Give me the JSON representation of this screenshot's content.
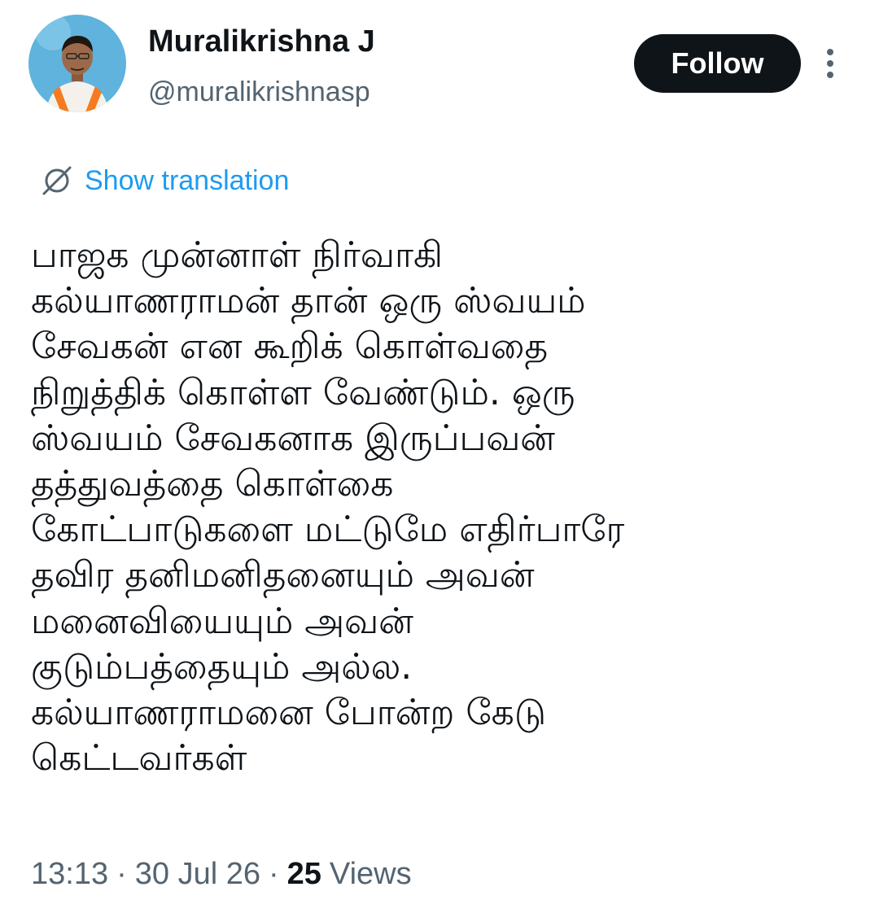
{
  "author": {
    "display_name": "Muralikrishna J",
    "handle": "@muralikrishnasp",
    "avatar_icon": "profile-photo"
  },
  "follow_label": "Follow",
  "more_icon": "more-vertical-icon",
  "translation": {
    "icon": "globe-slash-icon",
    "label": "Show translation"
  },
  "tweet": {
    "lines": [
      "பாஜக முன்னாள் நிர்வாகி",
      "கல்யாணராமன் தான் ஒரு ஸ்வயம்",
      "சேவகன் என கூறிக் கொள்வதை",
      "நிறுத்திக் கொள்ள வேண்டும். ஒரு",
      "ஸ்வயம் சேவகனாக இருப்பவன்",
      "தத்துவத்தை கொள்கை",
      "கோட்பாடுகளை மட்டுமே எதிர்பாரே",
      "தவிர தனிமனிதனையும் அவன்",
      "மனைவியையும் அவன்",
      "குடும்பத்தையும் அல்ல.",
      "கல்யாணராமனை போன்ற கேடு",
      "கெட்டவர்கள்"
    ]
  },
  "meta": {
    "time": "13:13",
    "separator": "·",
    "date": "30 Jul 26",
    "views_count": "25",
    "views_label": "Views"
  },
  "colors": {
    "text_primary": "#0f1419",
    "text_secondary": "#536471",
    "link_blue": "#1d9bf0",
    "button_bg": "#0f1419",
    "avatar_bg": "#5fb3dc",
    "saffron": "#f47b20"
  }
}
